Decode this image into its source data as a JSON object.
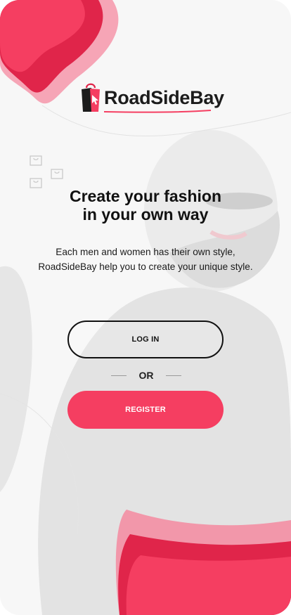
{
  "brand": {
    "name": "RoadSideBay"
  },
  "hero": {
    "title_line1": "Create your fashion",
    "title_line2": "in your own way",
    "desc_line1": "Each men and women has their own style,",
    "desc_line2": "RoadSideBay help you to create your unique style."
  },
  "actions": {
    "login_label": "LOG IN",
    "or_label": "OR",
    "register_label": "REGISTER"
  },
  "colors": {
    "accent": "#f53e61",
    "accent_light": "#f58aa0",
    "accent_dark": "#e0254a",
    "text": "#111111"
  },
  "icons": [
    "shopping-bag-icon",
    "shopping-bag-icon",
    "shopping-bag-icon"
  ]
}
